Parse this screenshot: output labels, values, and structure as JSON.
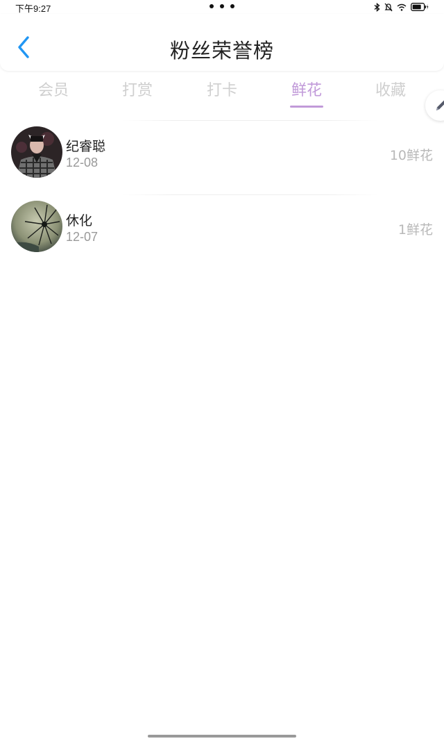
{
  "status_bar": {
    "time": "下午9:27"
  },
  "header": {
    "title": "粉丝荣誉榜",
    "back_icon": "chevron-left-icon",
    "accent_color": "#2196F3"
  },
  "tabs": [
    {
      "label": "会员",
      "active": false
    },
    {
      "label": "打赏",
      "active": false
    },
    {
      "label": "打卡",
      "active": false
    },
    {
      "label": "鲜花",
      "active": true
    },
    {
      "label": "收藏",
      "active": false
    }
  ],
  "tab_active_color": "#c19ad9",
  "edit_icon": "pencil-icon",
  "list": [
    {
      "name": "纪睿聪",
      "date": "12-08",
      "value": "10鲜花",
      "avatar": "avatar-person-icon"
    },
    {
      "name": "休化",
      "date": "12-07",
      "value": "1鲜花",
      "avatar": "avatar-dandelion-icon"
    }
  ]
}
